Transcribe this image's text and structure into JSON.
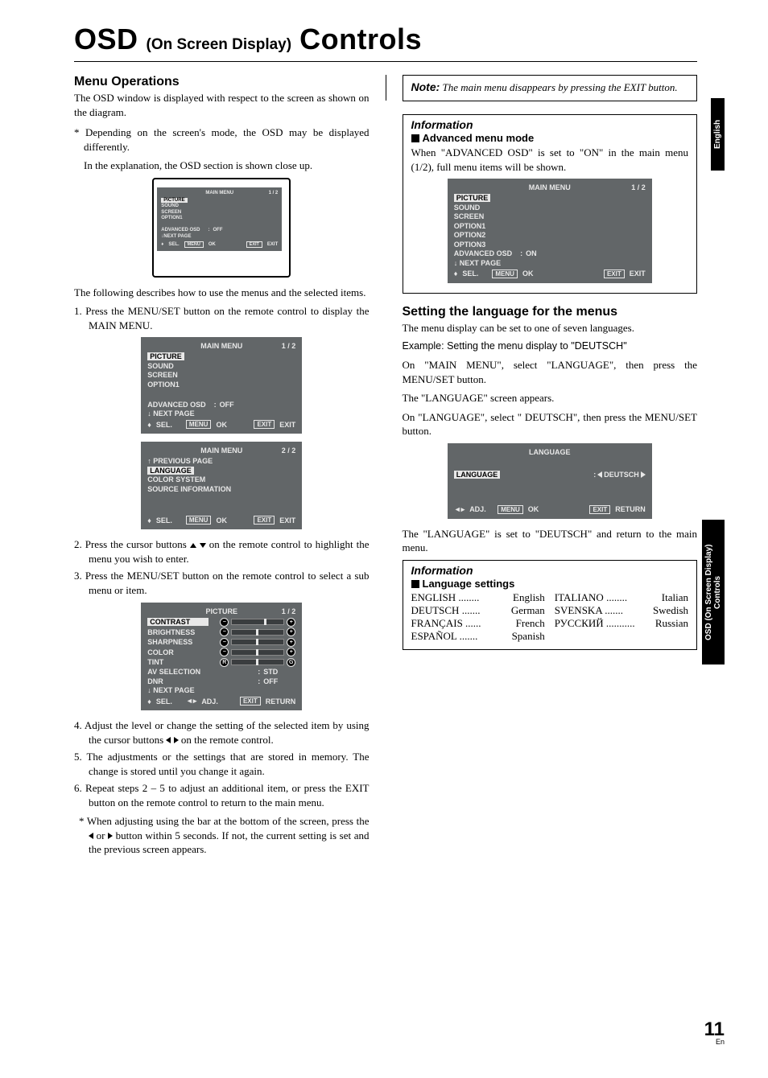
{
  "title": {
    "big1": "OSD",
    "mid": "(On Screen Display)",
    "big2": "Controls"
  },
  "left": {
    "h2": "Menu Operations",
    "p1": "The OSD window is displayed with respect to the screen as shown on the diagram.",
    "p2": "* Depending on the screen's mode, the OSD may be displayed differently.",
    "p3": "In the explanation, the OSD section is shown close up.",
    "p4": "The following describes how to use the menus and the selected items.",
    "s1": "1. Press the MENU/SET button on the remote control to display the MAIN MENU.",
    "s2a": "2. Press the cursor buttons ",
    "s2b": " on the remote control to highlight the menu you wish to enter.",
    "s3": "3. Press the MENU/SET button on the remote control to select a sub menu or item.",
    "s4a": "4. Adjust the level or change the setting of the selected item by using the cursor buttons ",
    "s4b": " on the remote control.",
    "s5": "5. The adjustments or the settings that are stored in memory. The change is stored until you change it again.",
    "s6": "6. Repeat steps 2 – 5 to adjust an additional item, or press the EXIT button on the remote control to return to the main menu.",
    "star2a": "* When adjusting using the bar at the bottom of the screen, press the ",
    "star2mid": " or ",
    "star2b": " button within 5 seconds. If not, the current setting is set and the previous screen appears."
  },
  "right": {
    "note_label": "Note:",
    "note_text": " The main menu disappears by pressing the EXIT button.",
    "info1_title": "Information",
    "info1_sub": "Advanced menu mode",
    "info1_text": "When \"ADVANCED OSD\" is set to \"ON\" in the main menu (1/2), full menu items will be shown.",
    "h2": "Setting the language for the menus",
    "p1": "The menu display can be set to one of seven languages.",
    "ex": "Example: Setting the menu display to \"DEUTSCH\"",
    "p2": "On \"MAIN MENU\", select \"LANGUAGE\", then press the MENU/SET button.",
    "p3": "The \"LANGUAGE\" screen appears.",
    "p4": "On \"LANGUAGE\", select \" DEUTSCH\", then press the MENU/SET button.",
    "p5": "The \"LANGUAGE\" is set to \"DEUTSCH\" and return to the main menu.",
    "info2_title": "Information",
    "info2_sub": "Language settings",
    "langs_left": [
      [
        "ENGLISH",
        "English"
      ],
      [
        "DEUTSCH",
        "German"
      ],
      [
        "FRANÇAIS",
        "French"
      ],
      [
        "ESPAÑOL",
        "Spanish"
      ]
    ],
    "langs_right": [
      [
        "ITALIANO",
        "Italian"
      ],
      [
        "SVENSKA",
        "Swedish"
      ],
      [
        "РУССКИЙ",
        "Russian"
      ]
    ]
  },
  "osd": {
    "main_title": "MAIN MENU",
    "pg12": "1 / 2",
    "pg22": "2 / 2",
    "picture": "PICTURE",
    "sound": "SOUND",
    "screen": "SCREEN",
    "option1": "OPTION1",
    "option2": "OPTION2",
    "option3": "OPTION3",
    "adv": "ADVANCED OSD",
    "off": "OFF",
    "on": "ON",
    "next": "NEXT PAGE",
    "prev": "PREVIOUS PAGE",
    "language": "LANGUAGE",
    "colorsys": "COLOR SYSTEM",
    "srcinfo": "SOURCE INFORMATION",
    "sel": "SEL.",
    "adj": "ADJ.",
    "menu": "MENU",
    "ok": "OK",
    "exit": "EXIT",
    "exit2": "EXIT",
    "return": "RETURN",
    "pic_title": "PICTURE",
    "contrast": "CONTRAST",
    "brightness": "BRIGHTNESS",
    "sharpness": "SHARPNESS",
    "color": "COLOR",
    "tint": "TINT",
    "avsel": "AV SELECTION",
    "std": "STD",
    "dnr": "DNR",
    "lang_title": "LANGUAGE",
    "lang_label": "LANGUAGE",
    "deutsch": "DEUTSCH",
    "colonsp": ": "
  },
  "tabs": {
    "english": "English",
    "section": "OSD (On Screen Display) Controls"
  },
  "page": {
    "num": "11",
    "en": "En"
  }
}
